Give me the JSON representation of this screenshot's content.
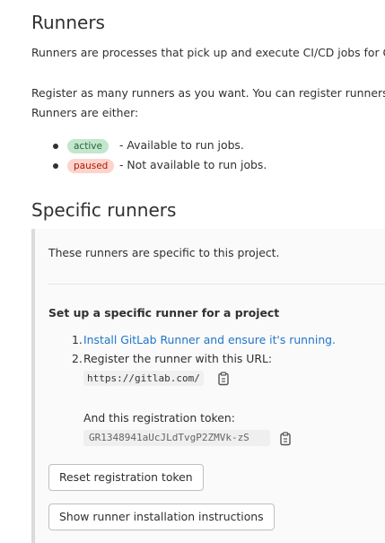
{
  "runners_section": {
    "title": "Runners",
    "intro": "Runners are processes that pick up and execute CI/CD jobs for G",
    "register_line1": "Register as many runners as you want. You can register runners a",
    "register_line2": "Runners are either:",
    "states": [
      {
        "badge": "active",
        "description": "- Available to run jobs."
      },
      {
        "badge": "paused",
        "description": "- Not available to run jobs."
      }
    ]
  },
  "specific_section": {
    "title": "Specific runners",
    "description": "These runners are specific to this project.",
    "setup_title": "Set up a specific runner for a project",
    "steps": [
      {
        "number": "1.",
        "text": "Install GitLab Runner and ensure it's running."
      },
      {
        "number": "2.",
        "text": "Register the runner with this URL:"
      }
    ],
    "url": "https://gitlab.com/",
    "token_label": "And this registration token:",
    "token_value": "GR1348941aUcJLdTvgP2ZMVk-zS",
    "reset_button": "Reset registration token",
    "instructions_button": "Show runner installation instructions"
  },
  "icons": {
    "copy_url": "clipboard-icon",
    "copy_token": "clipboard-icon"
  },
  "colors": {
    "link": "#1f75cb",
    "active_badge_bg": "#c3e6cd",
    "paused_badge_bg": "#fdd4cd"
  }
}
